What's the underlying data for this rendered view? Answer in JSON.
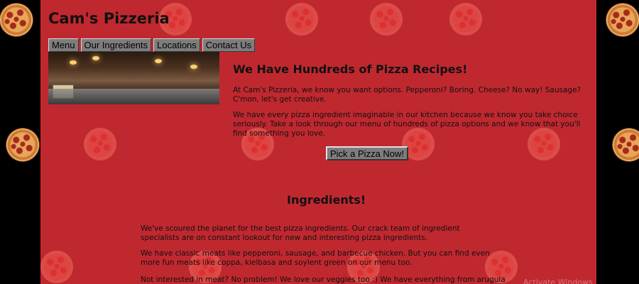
{
  "site": {
    "title": "Cam's Pizzeria"
  },
  "nav": {
    "items": [
      {
        "label": "Menu"
      },
      {
        "label": "Our Ingredients"
      },
      {
        "label": "Locations"
      },
      {
        "label": "Contact Us"
      }
    ]
  },
  "hero": {
    "image_alt": "pizzeria interior photo",
    "headline": "We Have Hundreds of Pizza Recipes!",
    "paragraphs": [
      "At Cam's Pizzeria, we know you want options. Pepperoni? Boring. Cheese? No way! Sausage? C'mon, let's get creative.",
      "We have every pizza ingredient imaginable in our kitchen because we know you take choice seriously. Take a look through our menu of hundreds of pizza options and we know that you'll find something you love."
    ],
    "cta_label": "Pick a Pizza Now!"
  },
  "ingredients": {
    "title": "Ingredients!",
    "paragraphs": [
      "We've scoured the planet for the best pizza ingredients. Our crack team of ingredient specialists are on constant lookout for new and interesting pizza ingredients.",
      "We have classic meats like pepperoni, sausage, and barbecue chicken. But you can find even more fun meats like coppa, kielbasa and soylent green on our menu too.",
      "Not interested in meat? No problem! We love our veggies too :) We have everything from arugula to"
    ]
  },
  "watermark": {
    "text": "Activate Windows"
  },
  "colors": {
    "page_background": "#c0282f",
    "side_background": "#000000",
    "button_background": "#7d7d7d"
  },
  "icons": {
    "decoration": "pizza-icon"
  }
}
